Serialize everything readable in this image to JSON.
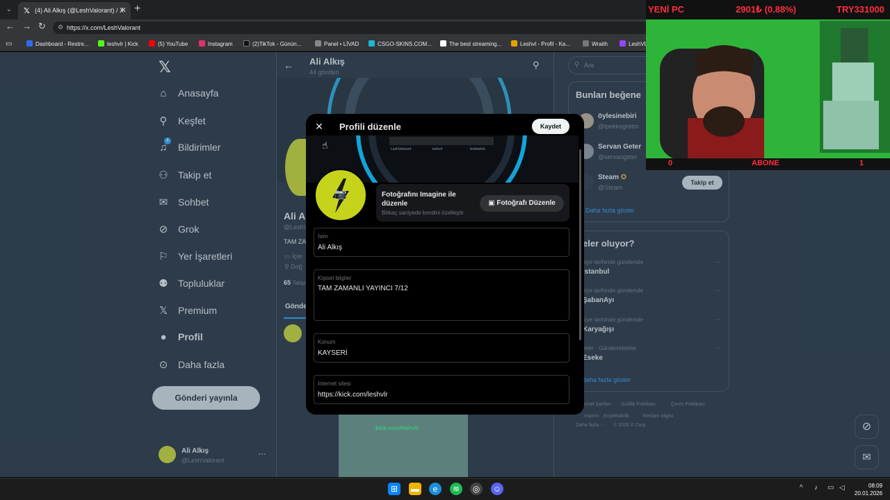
{
  "browser": {
    "tab_title": "(4) Ali Alkış (@LeshValorant) / X",
    "url": "https://x.com/LeshValorant",
    "bookmarks": [
      {
        "label": "Dashboard - Restre...",
        "color": "#2d6bf0"
      },
      {
        "label": "leshvlr | Kick",
        "color": "#53fc18"
      },
      {
        "label": "(5) YouTube",
        "color": "#ff0000"
      },
      {
        "label": "Instagram",
        "color": "#e1306c"
      },
      {
        "label": "(2)TikTok - Günün...",
        "color": "#111111"
      },
      {
        "label": "Panel • LİVAD",
        "color": "#888888"
      },
      {
        "label": "CSGO-SKINS.COM...",
        "color": "#1fb8d4"
      },
      {
        "label": "The best streaming...",
        "color": "#ffffff"
      },
      {
        "label": "Leshvl - Profil - Ka...",
        "color": "#e6a100"
      },
      {
        "label": "Wraith",
        "color": "#777777"
      },
      {
        "label": "LeshVL",
        "color": "#9146ff"
      }
    ]
  },
  "nav": {
    "items": [
      {
        "label": "Anasayfa",
        "icon": "home-icon",
        "glyph": "⌂"
      },
      {
        "label": "Keşfet",
        "icon": "search-icon",
        "glyph": "⚲"
      },
      {
        "label": "Bildirimler",
        "icon": "bell-icon",
        "glyph": "🔔"
      },
      {
        "label": "Takip et",
        "icon": "follow-icon",
        "glyph": "👤"
      },
      {
        "label": "Sohbet",
        "icon": "mail-icon",
        "glyph": "✉"
      },
      {
        "label": "Grok",
        "icon": "grok-icon",
        "glyph": "⊘"
      },
      {
        "label": "Yer İşaretleri",
        "icon": "bookmark-icon",
        "glyph": "⚐"
      },
      {
        "label": "Topluluklar",
        "icon": "communities-icon",
        "glyph": "👥"
      },
      {
        "label": "Premium",
        "icon": "premium-icon",
        "glyph": "𝕏"
      },
      {
        "label": "Profil",
        "icon": "profile-icon",
        "glyph": "👤"
      },
      {
        "label": "Daha fazla",
        "icon": "more-icon",
        "glyph": "⋯"
      }
    ],
    "notification_count": "4",
    "post_button": "Gönderi yayınla",
    "account_name": "Ali Alkış",
    "account_handle": "@LeshValorant"
  },
  "profile": {
    "name": "Ali Alkış",
    "post_count": "44 gönderi",
    "name_fragment": "Ali A",
    "handle_fragment": "@LeshV",
    "bio_fragment": "TAM ZA",
    "meta1": "İçer",
    "meta2": "Doğ",
    "following_count": "65",
    "following_fragment": "Takip",
    "tab_posts": "Gönde"
  },
  "right": {
    "search_placeholder": "Ara",
    "card1_title": "Bunları beğene",
    "suggestions": [
      {
        "name": "öylesinebiri",
        "handle": "@ipekkogretm",
        "color": "#b7a38a"
      },
      {
        "name": "Servan Geter",
        "handle": "@servangeter",
        "color": "#8a8f96"
      },
      {
        "name": "Steam",
        "handle": "@Steam",
        "color": "#1b2838"
      }
    ],
    "follow_label": "Takip et",
    "show_more": "Daha fazla göster",
    "card2_title": "eler oluyor?",
    "trends": [
      {
        "meta": "kiye tarihinde gündemde",
        "name": "İstanbul"
      },
      {
        "meta": "kiye tarihinde gündemde",
        "name": "ŞabanAyı"
      },
      {
        "meta": "kiye tarihinde gündemde",
        "name": "Karyağışı"
      },
      {
        "meta": "erler · Gündemdekiler",
        "name": "Eseke"
      }
    ],
    "show_more2": "daha fazla göster",
    "footer": [
      "izmet Şartları",
      "Gizlilik Politikası",
      "Çerez Politikası",
      "Imprint",
      "Erişilebilirlik",
      "Reklam bilgisi",
      "Daha fazla ···",
      "© 2026 X Corp."
    ]
  },
  "modal": {
    "title": "Profili düzenle",
    "save": "Kaydet",
    "imagine_title": "Fotoğrafını Imagine ile düzenle",
    "imagine_sub": "Birkaç saniyede kendini özelleştir",
    "edit_photo": "Fotoğrafı Düzenle",
    "banner_texts": [
      "LeshValorant",
      "leshvlr",
      "leshtwitch"
    ],
    "fields": [
      {
        "label": "İsim",
        "value": "Ali Alkış"
      },
      {
        "label": "Kişisel bilgiler",
        "value": "TAM ZAMANLI YAYINCI 7/12"
      },
      {
        "label": "Konum",
        "value": "KAYSERİ"
      },
      {
        "label": "İnternet sitesi",
        "value": "https://kick.com/leshvlr"
      }
    ]
  },
  "webcam": {
    "top_left": "YENİ PC",
    "top_mid": "2901₺ (0.88%)",
    "top_right": "TRY331000",
    "bottom_left": "0",
    "bottom_mid": "ABONE",
    "bottom_right": "1"
  },
  "video_text": "kick.com/leshvlr",
  "taskbar": {
    "time": "08:09",
    "date": "20.01.2026"
  }
}
